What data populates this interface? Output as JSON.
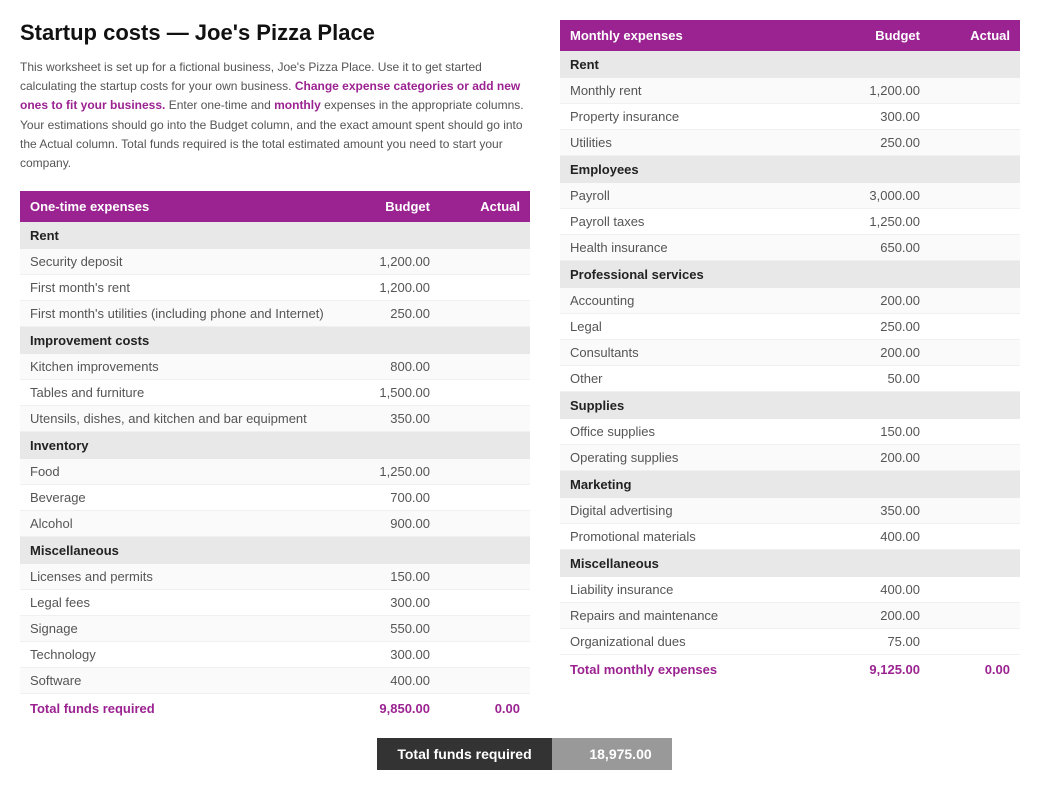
{
  "title": "Startup costs — Joe's Pizza Place",
  "description": {
    "text1": "This worksheet is set up for a fictional business, Joe's Pizza Place. Use it to get started calculating the startup costs for your own business.",
    "highlight1": "Change expense categories or add new ones to fit your business.",
    "text2": "Enter one-time and",
    "highlight2": "monthly",
    "text3": "expenses in the appropriate columns. Your estimations should go into the Budget column, and the exact amount spent should go into the Actual column. Total funds required is the total estimated amount you need to start your company."
  },
  "one_time": {
    "header": {
      "label": "One-time expenses",
      "budget": "Budget",
      "actual": "Actual"
    },
    "sections": [
      {
        "name": "Rent",
        "rows": [
          {
            "label": "Security deposit",
            "budget": "1,200.00",
            "actual": ""
          },
          {
            "label": "First month's rent",
            "budget": "1,200.00",
            "actual": ""
          },
          {
            "label": "First month's utilities (including phone and Internet)",
            "budget": "250.00",
            "actual": ""
          }
        ]
      },
      {
        "name": "Improvement costs",
        "rows": [
          {
            "label": "Kitchen improvements",
            "budget": "800.00",
            "actual": ""
          },
          {
            "label": "Tables and furniture",
            "budget": "1,500.00",
            "actual": ""
          },
          {
            "label": "Utensils, dishes, and kitchen and bar equipment",
            "budget": "350.00",
            "actual": ""
          }
        ]
      },
      {
        "name": "Inventory",
        "rows": [
          {
            "label": "Food",
            "budget": "1,250.00",
            "actual": ""
          },
          {
            "label": "Beverage",
            "budget": "700.00",
            "actual": ""
          },
          {
            "label": "Alcohol",
            "budget": "900.00",
            "actual": ""
          }
        ]
      },
      {
        "name": "Miscellaneous",
        "rows": [
          {
            "label": "Licenses and permits",
            "budget": "150.00",
            "actual": ""
          },
          {
            "label": "Legal fees",
            "budget": "300.00",
            "actual": ""
          },
          {
            "label": "Signage",
            "budget": "550.00",
            "actual": ""
          },
          {
            "label": "Technology",
            "budget": "300.00",
            "actual": ""
          },
          {
            "label": "Software",
            "budget": "400.00",
            "actual": ""
          }
        ]
      }
    ],
    "total": {
      "label": "Total funds required",
      "budget": "9,850.00",
      "actual": "0.00"
    }
  },
  "monthly": {
    "header": {
      "label": "Monthly expenses",
      "budget": "Budget",
      "actual": "Actual"
    },
    "sections": [
      {
        "name": "Rent",
        "rows": [
          {
            "label": "Monthly rent",
            "budget": "1,200.00",
            "actual": ""
          },
          {
            "label": "Property insurance",
            "budget": "300.00",
            "actual": ""
          },
          {
            "label": "Utilities",
            "budget": "250.00",
            "actual": ""
          }
        ]
      },
      {
        "name": "Employees",
        "rows": [
          {
            "label": "Payroll",
            "budget": "3,000.00",
            "actual": ""
          },
          {
            "label": "Payroll taxes",
            "budget": "1,250.00",
            "actual": ""
          },
          {
            "label": "Health insurance",
            "budget": "650.00",
            "actual": ""
          }
        ]
      },
      {
        "name": "Professional services",
        "rows": [
          {
            "label": "Accounting",
            "budget": "200.00",
            "actual": ""
          },
          {
            "label": "Legal",
            "budget": "250.00",
            "actual": ""
          },
          {
            "label": "Consultants",
            "budget": "200.00",
            "actual": ""
          },
          {
            "label": "Other",
            "budget": "50.00",
            "actual": ""
          }
        ]
      },
      {
        "name": "Supplies",
        "rows": [
          {
            "label": "Office supplies",
            "budget": "150.00",
            "actual": ""
          },
          {
            "label": "Operating supplies",
            "budget": "200.00",
            "actual": ""
          }
        ]
      },
      {
        "name": "Marketing",
        "rows": [
          {
            "label": "Digital advertising",
            "budget": "350.00",
            "actual": ""
          },
          {
            "label": "Promotional materials",
            "budget": "400.00",
            "actual": ""
          }
        ]
      },
      {
        "name": "Miscellaneous",
        "rows": [
          {
            "label": "Liability insurance",
            "budget": "400.00",
            "actual": ""
          },
          {
            "label": "Repairs and maintenance",
            "budget": "200.00",
            "actual": ""
          },
          {
            "label": "Organizational dues",
            "budget": "75.00",
            "actual": ""
          }
        ]
      }
    ],
    "total": {
      "label": "Total monthly expenses",
      "budget": "9,125.00",
      "actual": "0.00"
    }
  },
  "footer": {
    "label": "Total funds required",
    "value": "18,975.00"
  }
}
